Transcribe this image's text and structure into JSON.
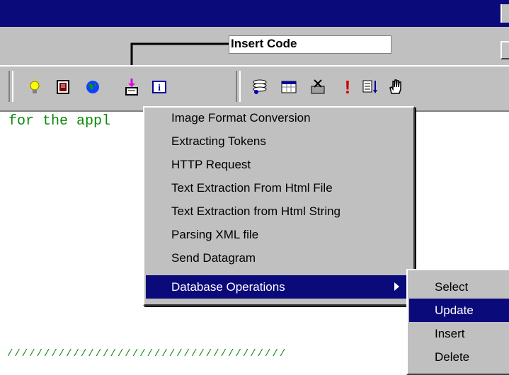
{
  "callout": {
    "label": "Insert Code"
  },
  "editor": {
    "code_line": "for the appl",
    "bottom_line": "//////////////////////////////////////"
  },
  "toolbar": {
    "group1_icons": [
      "lightbulb-icon",
      "book-icon",
      "globe-icon",
      "insert-code-icon",
      "info-icon"
    ],
    "group2_icons": [
      "database-icon",
      "calendar-icon",
      "delete-table-icon",
      "exclamation-icon",
      "sort-icon",
      "hand-icon"
    ]
  },
  "menu": {
    "items": [
      {
        "label": "Image Format Conversion"
      },
      {
        "label": "Extracting Tokens"
      },
      {
        "label": "HTTP Request"
      },
      {
        "label": "Text Extraction From Html File"
      },
      {
        "label": "Text Extraction from Html String"
      },
      {
        "label": "Parsing XML file"
      },
      {
        "label": "Send Datagram"
      },
      {
        "label": "Database Operations"
      }
    ],
    "selected": "Database Operations"
  },
  "submenu": {
    "items": [
      {
        "label": "Select"
      },
      {
        "label": "Update"
      },
      {
        "label": "Insert"
      },
      {
        "label": "Delete"
      }
    ],
    "selected": "Update"
  },
  "colors": {
    "title_bar": "#0a0a7a",
    "selection": "#0a0a7a",
    "chrome": "#c0c0c0",
    "code_text": "#0a8a0a"
  }
}
